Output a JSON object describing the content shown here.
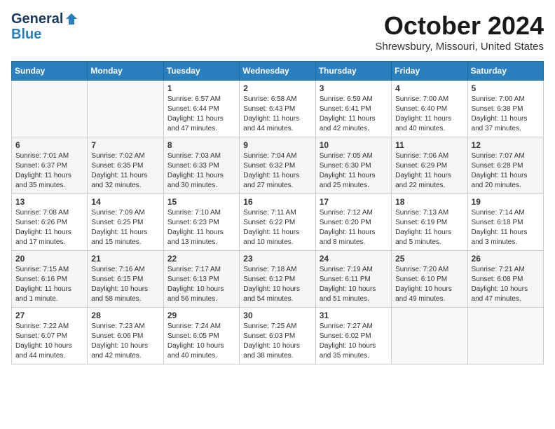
{
  "header": {
    "logo_line1": "General",
    "logo_line2": "Blue",
    "month": "October 2024",
    "location": "Shrewsbury, Missouri, United States"
  },
  "weekdays": [
    "Sunday",
    "Monday",
    "Tuesday",
    "Wednesday",
    "Thursday",
    "Friday",
    "Saturday"
  ],
  "weeks": [
    [
      {
        "day": "",
        "sunrise": "",
        "sunset": "",
        "daylight": ""
      },
      {
        "day": "",
        "sunrise": "",
        "sunset": "",
        "daylight": ""
      },
      {
        "day": "1",
        "sunrise": "Sunrise: 6:57 AM",
        "sunset": "Sunset: 6:44 PM",
        "daylight": "Daylight: 11 hours and 47 minutes."
      },
      {
        "day": "2",
        "sunrise": "Sunrise: 6:58 AM",
        "sunset": "Sunset: 6:43 PM",
        "daylight": "Daylight: 11 hours and 44 minutes."
      },
      {
        "day": "3",
        "sunrise": "Sunrise: 6:59 AM",
        "sunset": "Sunset: 6:41 PM",
        "daylight": "Daylight: 11 hours and 42 minutes."
      },
      {
        "day": "4",
        "sunrise": "Sunrise: 7:00 AM",
        "sunset": "Sunset: 6:40 PM",
        "daylight": "Daylight: 11 hours and 40 minutes."
      },
      {
        "day": "5",
        "sunrise": "Sunrise: 7:00 AM",
        "sunset": "Sunset: 6:38 PM",
        "daylight": "Daylight: 11 hours and 37 minutes."
      }
    ],
    [
      {
        "day": "6",
        "sunrise": "Sunrise: 7:01 AM",
        "sunset": "Sunset: 6:37 PM",
        "daylight": "Daylight: 11 hours and 35 minutes."
      },
      {
        "day": "7",
        "sunrise": "Sunrise: 7:02 AM",
        "sunset": "Sunset: 6:35 PM",
        "daylight": "Daylight: 11 hours and 32 minutes."
      },
      {
        "day": "8",
        "sunrise": "Sunrise: 7:03 AM",
        "sunset": "Sunset: 6:33 PM",
        "daylight": "Daylight: 11 hours and 30 minutes."
      },
      {
        "day": "9",
        "sunrise": "Sunrise: 7:04 AM",
        "sunset": "Sunset: 6:32 PM",
        "daylight": "Daylight: 11 hours and 27 minutes."
      },
      {
        "day": "10",
        "sunrise": "Sunrise: 7:05 AM",
        "sunset": "Sunset: 6:30 PM",
        "daylight": "Daylight: 11 hours and 25 minutes."
      },
      {
        "day": "11",
        "sunrise": "Sunrise: 7:06 AM",
        "sunset": "Sunset: 6:29 PM",
        "daylight": "Daylight: 11 hours and 22 minutes."
      },
      {
        "day": "12",
        "sunrise": "Sunrise: 7:07 AM",
        "sunset": "Sunset: 6:28 PM",
        "daylight": "Daylight: 11 hours and 20 minutes."
      }
    ],
    [
      {
        "day": "13",
        "sunrise": "Sunrise: 7:08 AM",
        "sunset": "Sunset: 6:26 PM",
        "daylight": "Daylight: 11 hours and 17 minutes."
      },
      {
        "day": "14",
        "sunrise": "Sunrise: 7:09 AM",
        "sunset": "Sunset: 6:25 PM",
        "daylight": "Daylight: 11 hours and 15 minutes."
      },
      {
        "day": "15",
        "sunrise": "Sunrise: 7:10 AM",
        "sunset": "Sunset: 6:23 PM",
        "daylight": "Daylight: 11 hours and 13 minutes."
      },
      {
        "day": "16",
        "sunrise": "Sunrise: 7:11 AM",
        "sunset": "Sunset: 6:22 PM",
        "daylight": "Daylight: 11 hours and 10 minutes."
      },
      {
        "day": "17",
        "sunrise": "Sunrise: 7:12 AM",
        "sunset": "Sunset: 6:20 PM",
        "daylight": "Daylight: 11 hours and 8 minutes."
      },
      {
        "day": "18",
        "sunrise": "Sunrise: 7:13 AM",
        "sunset": "Sunset: 6:19 PM",
        "daylight": "Daylight: 11 hours and 5 minutes."
      },
      {
        "day": "19",
        "sunrise": "Sunrise: 7:14 AM",
        "sunset": "Sunset: 6:18 PM",
        "daylight": "Daylight: 11 hours and 3 minutes."
      }
    ],
    [
      {
        "day": "20",
        "sunrise": "Sunrise: 7:15 AM",
        "sunset": "Sunset: 6:16 PM",
        "daylight": "Daylight: 11 hours and 1 minute."
      },
      {
        "day": "21",
        "sunrise": "Sunrise: 7:16 AM",
        "sunset": "Sunset: 6:15 PM",
        "daylight": "Daylight: 10 hours and 58 minutes."
      },
      {
        "day": "22",
        "sunrise": "Sunrise: 7:17 AM",
        "sunset": "Sunset: 6:13 PM",
        "daylight": "Daylight: 10 hours and 56 minutes."
      },
      {
        "day": "23",
        "sunrise": "Sunrise: 7:18 AM",
        "sunset": "Sunset: 6:12 PM",
        "daylight": "Daylight: 10 hours and 54 minutes."
      },
      {
        "day": "24",
        "sunrise": "Sunrise: 7:19 AM",
        "sunset": "Sunset: 6:11 PM",
        "daylight": "Daylight: 10 hours and 51 minutes."
      },
      {
        "day": "25",
        "sunrise": "Sunrise: 7:20 AM",
        "sunset": "Sunset: 6:10 PM",
        "daylight": "Daylight: 10 hours and 49 minutes."
      },
      {
        "day": "26",
        "sunrise": "Sunrise: 7:21 AM",
        "sunset": "Sunset: 6:08 PM",
        "daylight": "Daylight: 10 hours and 47 minutes."
      }
    ],
    [
      {
        "day": "27",
        "sunrise": "Sunrise: 7:22 AM",
        "sunset": "Sunset: 6:07 PM",
        "daylight": "Daylight: 10 hours and 44 minutes."
      },
      {
        "day": "28",
        "sunrise": "Sunrise: 7:23 AM",
        "sunset": "Sunset: 6:06 PM",
        "daylight": "Daylight: 10 hours and 42 minutes."
      },
      {
        "day": "29",
        "sunrise": "Sunrise: 7:24 AM",
        "sunset": "Sunset: 6:05 PM",
        "daylight": "Daylight: 10 hours and 40 minutes."
      },
      {
        "day": "30",
        "sunrise": "Sunrise: 7:25 AM",
        "sunset": "Sunset: 6:03 PM",
        "daylight": "Daylight: 10 hours and 38 minutes."
      },
      {
        "day": "31",
        "sunrise": "Sunrise: 7:27 AM",
        "sunset": "Sunset: 6:02 PM",
        "daylight": "Daylight: 10 hours and 35 minutes."
      },
      {
        "day": "",
        "sunrise": "",
        "sunset": "",
        "daylight": ""
      },
      {
        "day": "",
        "sunrise": "",
        "sunset": "",
        "daylight": ""
      }
    ]
  ]
}
